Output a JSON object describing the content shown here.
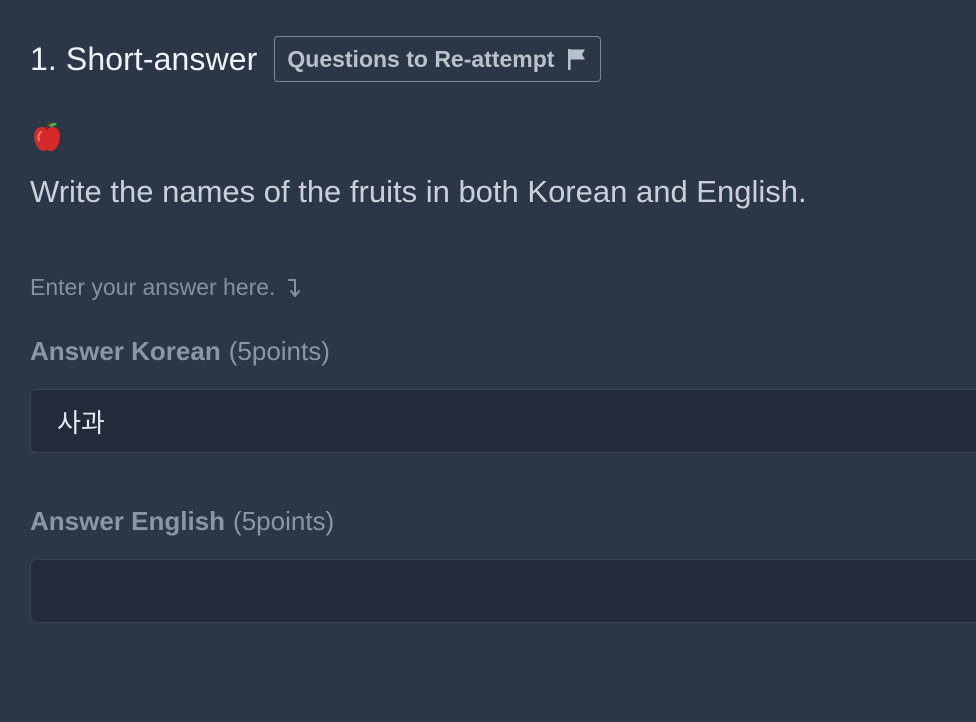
{
  "question": {
    "title": "1. Short-answer",
    "reattempt_label": "Questions to Re-attempt",
    "prompt": "Write the names of the fruits in both Korean and English.",
    "image_icon": "apple-icon"
  },
  "answer_hint": {
    "text": "Enter your answer here.",
    "icon": "arrow-down-right-icon"
  },
  "answers": {
    "korean": {
      "label": "Answer Korean",
      "points": "(5points)",
      "value": "사과"
    },
    "english": {
      "label": "Answer English",
      "points": "(5points)",
      "value": ""
    }
  },
  "colors": {
    "background": "#2b3747",
    "input_background": "#222b3a",
    "muted_text": "#8a96a6"
  }
}
